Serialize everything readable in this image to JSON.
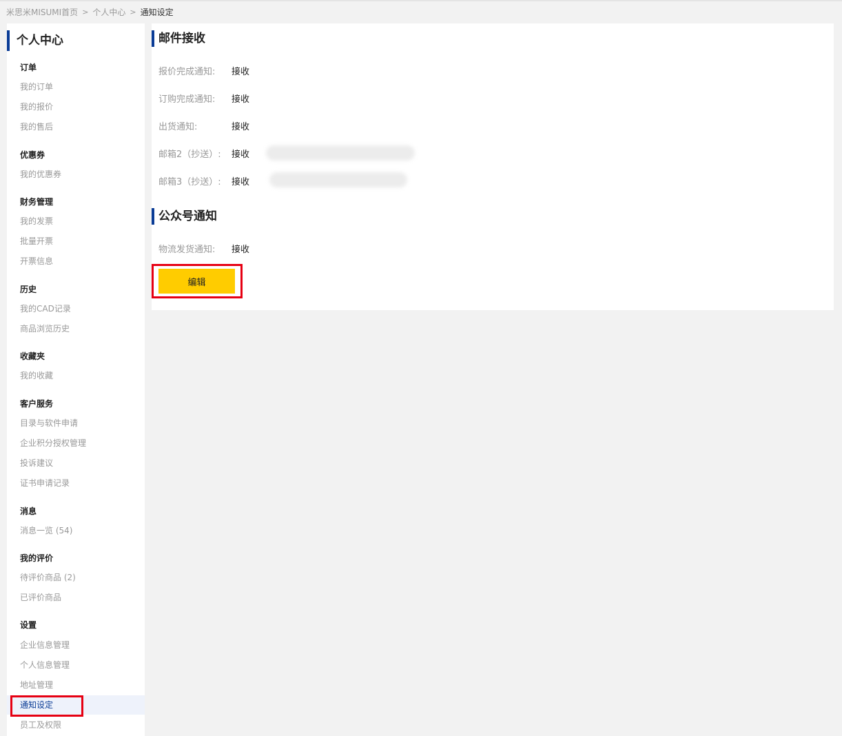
{
  "breadcrumb": {
    "home": "米思米MISUMI首页",
    "user_center": "个人中心",
    "current": "通知设定",
    "separator": ">"
  },
  "sidebar": {
    "title": "个人中心",
    "sections": [
      {
        "heading": "订单",
        "items": [
          "我的订单",
          "我的报价",
          "我的售后"
        ]
      },
      {
        "heading": "优惠券",
        "items": [
          "我的优惠券"
        ]
      },
      {
        "heading": "财务管理",
        "items": [
          "我的发票",
          "批量开票",
          "开票信息"
        ]
      },
      {
        "heading": "历史",
        "items": [
          "我的CAD记录",
          "商品浏览历史"
        ]
      },
      {
        "heading": "收藏夹",
        "items": [
          "我的收藏"
        ]
      },
      {
        "heading": "客户服务",
        "items": [
          "目录与软件申请",
          "企业积分授权管理",
          "投诉建议",
          "证书申请记录"
        ]
      },
      {
        "heading": "消息",
        "items": [
          "消息一览 (54)"
        ]
      },
      {
        "heading": "我的评价",
        "items": [
          "待评价商品 (2)",
          "已评价商品"
        ]
      },
      {
        "heading": "设置",
        "items": [
          "企业信息管理",
          "个人信息管理",
          "地址管理",
          "通知设定",
          "员工及权限"
        ]
      }
    ]
  },
  "main": {
    "email_section": {
      "title": "邮件接收",
      "rows": [
        {
          "label": "报价完成通知:",
          "value": "接收"
        },
        {
          "label": "订购完成通知:",
          "value": "接收"
        },
        {
          "label": "出货通知:",
          "value": "接收"
        },
        {
          "label": "邮箱2（抄送）:",
          "value": "接收"
        },
        {
          "label": "邮箱3（抄送）:",
          "value": "接收"
        }
      ]
    },
    "wechat_section": {
      "title": "公众号通知",
      "rows": [
        {
          "label": "物流发货通知:",
          "value": "接收"
        }
      ]
    },
    "edit_button": "编辑"
  },
  "colors": {
    "accent_blue": "#0a3c96",
    "button_yellow": "#ffcc00",
    "highlight_red": "#e60012",
    "background": "#f2f2f2"
  }
}
